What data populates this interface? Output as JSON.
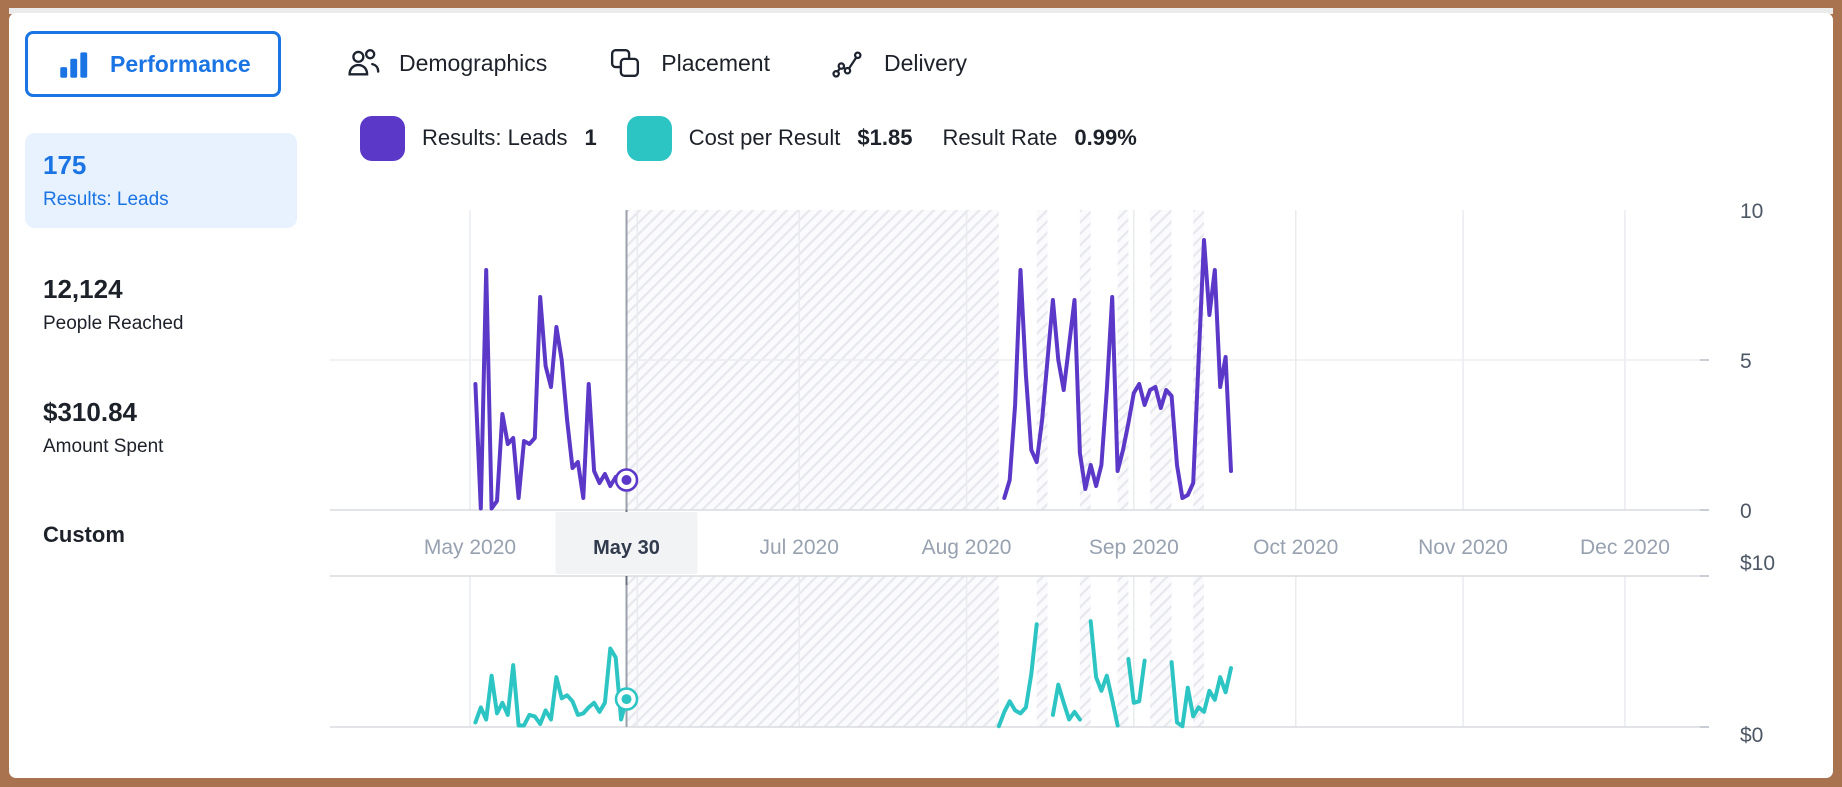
{
  "tabs": [
    {
      "label": "Performance",
      "icon": "bar-chart-icon",
      "active": true
    },
    {
      "label": "Demographics",
      "icon": "people-icon",
      "active": false
    },
    {
      "label": "Placement",
      "icon": "overlapping-squares-icon",
      "active": false
    },
    {
      "label": "Delivery",
      "icon": "trend-line-icon",
      "active": false
    }
  ],
  "sidebar": {
    "metrics": [
      {
        "value": "175",
        "label": "Results: Leads",
        "selected": true
      },
      {
        "value": "12,124",
        "label": "People Reached",
        "selected": false
      },
      {
        "value": "$310.84",
        "label": "Amount Spent",
        "selected": false
      }
    ],
    "footer_label": "Custom"
  },
  "legend": [
    {
      "swatch": "#5B38C8",
      "label": "Results: Leads",
      "value": "1"
    },
    {
      "swatch": "#2CC5C4",
      "label": "Cost per Result",
      "value": "$1.85"
    },
    {
      "swatch": null,
      "label": "Result Rate",
      "value": "0.99%"
    }
  ],
  "colors": {
    "accent_blue": "#1b74e4",
    "purple": "#5B38C8",
    "teal": "#2CC5C4",
    "frame_brown": "#aa7350",
    "selected_card_bg": "#e8f2fe"
  },
  "chart_data": {
    "type": "line",
    "x_axis": {
      "unit": "days since 2020-05-01",
      "month_ticks": [
        {
          "label": "May 2020",
          "day": 0
        },
        {
          "label": "Jul 2020",
          "day": 61
        },
        {
          "label": "Aug 2020",
          "day": 92
        },
        {
          "label": "Sep 2020",
          "day": 123
        },
        {
          "label": "Oct 2020",
          "day": 153
        },
        {
          "label": "Nov 2020",
          "day": 184
        },
        {
          "label": "Dec 2020",
          "day": 214
        }
      ],
      "gridline_days": [
        0,
        31,
        61,
        92,
        123,
        153,
        184,
        214
      ],
      "selected_tick": {
        "label": "May 30",
        "day": 29
      },
      "no_data_hatch_day_ranges": [
        [
          29,
          98
        ],
        [
          105,
          107
        ],
        [
          113,
          115
        ],
        [
          120,
          122
        ],
        [
          126,
          130
        ],
        [
          134,
          136
        ]
      ]
    },
    "charts": [
      {
        "title": "Results: Leads",
        "series": "results-leads",
        "color": "#5B38C8",
        "ylim": [
          0,
          10
        ],
        "yticks": [
          {
            "label": "10",
            "value": 10
          },
          {
            "label": "5",
            "value": 5
          },
          {
            "label": "0",
            "value": 0
          }
        ],
        "selected_point": {
          "day": 29,
          "value": 1
        },
        "segments": [
          {
            "points": [
              [
                1,
                4.2
              ],
              [
                2,
                0.05
              ],
              [
                3,
                8
              ],
              [
                4,
                0.05
              ],
              [
                5,
                0.3
              ],
              [
                6,
                3.2
              ],
              [
                7,
                2.2
              ],
              [
                8,
                2.4
              ],
              [
                9,
                0.4
              ],
              [
                10,
                2.3
              ],
              [
                11,
                2.2
              ],
              [
                12,
                2.4
              ],
              [
                13,
                7.1
              ],
              [
                14,
                4.8
              ],
              [
                15,
                4.1
              ],
              [
                16,
                6.1
              ],
              [
                17,
                5
              ],
              [
                18,
                3
              ],
              [
                19,
                1.4
              ],
              [
                20,
                1.6
              ],
              [
                21,
                0.4
              ],
              [
                22,
                4.2
              ],
              [
                23,
                1.3
              ],
              [
                24,
                0.9
              ],
              [
                25,
                1.2
              ],
              [
                26,
                0.8
              ],
              [
                27,
                1.1
              ],
              [
                28,
                0.9
              ],
              [
                29,
                1
              ]
            ]
          },
          {
            "points": [
              [
                99,
                0.4
              ],
              [
                100,
                1
              ],
              [
                101,
                3.5
              ],
              [
                102,
                8
              ],
              [
                103,
                4.5
              ],
              [
                104,
                2
              ],
              [
                105,
                1.6
              ],
              [
                106,
                3
              ],
              [
                107,
                5
              ],
              [
                108,
                7
              ],
              [
                109,
                5
              ],
              [
                110,
                4
              ],
              [
                111,
                5.5
              ],
              [
                112,
                7
              ],
              [
                113,
                1.9
              ],
              [
                114,
                0.7
              ],
              [
                115,
                1.5
              ],
              [
                116,
                0.8
              ],
              [
                117,
                1.5
              ],
              [
                118,
                4
              ],
              [
                119,
                7.1
              ],
              [
                120,
                1.3
              ],
              [
                121,
                2
              ],
              [
                122,
                2.9
              ],
              [
                123,
                3.9
              ],
              [
                124,
                4.2
              ],
              [
                125,
                3.5
              ],
              [
                126,
                4
              ],
              [
                127,
                4.1
              ],
              [
                128,
                3.4
              ],
              [
                129,
                4
              ],
              [
                130,
                3.8
              ],
              [
                131,
                1.5
              ],
              [
                132,
                0.4
              ],
              [
                133,
                0.5
              ],
              [
                134,
                0.9
              ],
              [
                135,
                5
              ],
              [
                136,
                9
              ],
              [
                137,
                6.5
              ],
              [
                138,
                8
              ],
              [
                139,
                4.1
              ],
              [
                140,
                5.1
              ],
              [
                141,
                1.3
              ]
            ]
          }
        ]
      },
      {
        "title": "Cost per Result",
        "series": "cost-per-result",
        "color": "#2CC5C4",
        "ylim": [
          0,
          10
        ],
        "yticks": [
          {
            "label": "$10",
            "value": 10
          },
          {
            "label": "$0",
            "value": 0
          }
        ],
        "selected_point": {
          "day": 29,
          "value": 1.85
        },
        "segments": [
          {
            "points": [
              [
                1,
                0.3
              ],
              [
                2,
                1.3
              ],
              [
                3,
                0.5
              ],
              [
                4,
                3.4
              ],
              [
                5,
                0.9
              ],
              [
                6,
                1.6
              ],
              [
                7,
                0.8
              ],
              [
                8,
                4.1
              ],
              [
                9,
                0.1
              ],
              [
                10,
                0.1
              ],
              [
                11,
                0.8
              ],
              [
                12,
                0.7
              ],
              [
                13,
                0.2
              ],
              [
                14,
                1.1
              ],
              [
                15,
                0.5
              ],
              [
                16,
                3.3
              ],
              [
                17,
                1.9
              ],
              [
                18,
                2.1
              ],
              [
                19,
                1.7
              ],
              [
                20,
                0.8
              ],
              [
                21,
                0.9
              ],
              [
                22,
                1.3
              ],
              [
                23,
                1.6
              ],
              [
                24,
                1
              ],
              [
                25,
                1.6
              ],
              [
                26,
                5.2
              ],
              [
                27,
                4.6
              ],
              [
                28,
                0.5
              ],
              [
                29,
                1.85
              ]
            ]
          },
          {
            "points": [
              [
                98,
                0.05
              ],
              [
                99,
                1
              ],
              [
                100,
                1.7
              ],
              [
                101,
                1.1
              ],
              [
                102,
                0.9
              ],
              [
                103,
                1.3
              ],
              [
                104,
                3.5
              ],
              [
                105,
                6.8
              ]
            ]
          },
          {
            "points": [
              [
                108,
                0.8
              ],
              [
                109,
                2.8
              ],
              [
                110,
                1.6
              ],
              [
                111,
                0.5
              ],
              [
                112,
                1
              ],
              [
                113,
                0.5
              ]
            ]
          },
          {
            "points": [
              [
                115,
                7
              ],
              [
                116,
                3.3
              ],
              [
                117,
                2.4
              ],
              [
                118,
                3.4
              ],
              [
                119,
                1.8
              ],
              [
                120,
                0.1
              ]
            ]
          },
          {
            "points": [
              [
                122,
                4.5
              ],
              [
                123,
                1.6
              ],
              [
                124,
                1.7
              ],
              [
                125,
                4.4
              ]
            ]
          },
          {
            "points": [
              [
                130,
                4.3
              ],
              [
                131,
                0.3
              ],
              [
                132,
                0.05
              ],
              [
                133,
                2.6
              ],
              [
                134,
                0.7
              ],
              [
                135,
                1.3
              ],
              [
                136,
                1
              ],
              [
                137,
                2.4
              ],
              [
                138,
                1.8
              ],
              [
                139,
                3.3
              ],
              [
                140,
                2.3
              ],
              [
                141,
                3.9
              ]
            ]
          }
        ]
      }
    ]
  }
}
